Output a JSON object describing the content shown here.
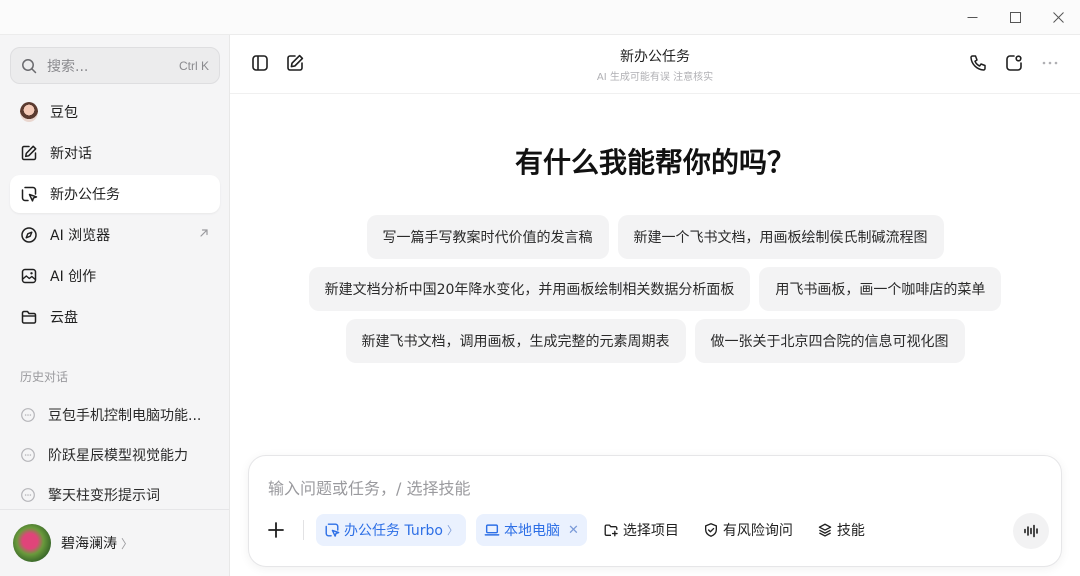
{
  "window": {
    "controls": [
      "minimize",
      "maximize",
      "close"
    ]
  },
  "search": {
    "placeholder": "搜索...",
    "shortcut": "Ctrl K"
  },
  "nav": [
    {
      "label": "豆包",
      "icon": "avatar-icon"
    },
    {
      "label": "新对话",
      "icon": "edit-icon"
    },
    {
      "label": "新办公任务",
      "icon": "office-task-icon",
      "active": true
    },
    {
      "label": "AI 浏览器",
      "icon": "compass-icon",
      "external": true
    },
    {
      "label": "AI 创作",
      "icon": "image-create-icon"
    },
    {
      "label": "云盘",
      "icon": "folder-icon"
    }
  ],
  "history": {
    "title": "历史对话",
    "items": [
      "豆包手机控制电脑功能...",
      "阶跃星辰模型视觉能力",
      "擎天柱变形提示词"
    ]
  },
  "user": {
    "name": "碧海澜涛",
    "chevron": "〉"
  },
  "header": {
    "title": "新办公任务",
    "subtitle": "AI 生成可能有误 注意核实"
  },
  "main": {
    "headline": "有什么我能帮你的吗？"
  },
  "suggestions": [
    [
      "写一篇手写教案时代价值的发言稿",
      "新建一个飞书文档，用画板绘制侯氏制碱流程图"
    ],
    [
      "新建文档分析中国20年降水变化，并用画板绘制相关数据分析面板",
      "用飞书画板，画一个咖啡店的菜单"
    ],
    [
      "新建飞书文档，调用画板，生成完整的元素周期表",
      "做一张关于北京四合院的信息可视化图"
    ]
  ],
  "composer": {
    "placeholder": "输入问题或任务，/ 选择技能",
    "mode_label": "办公任务 Turbo",
    "mode_arrow": "〉",
    "device_label": "本地电脑",
    "device_close": "✕",
    "project_label": "选择项目",
    "risk_label": "有风险询问",
    "skills_label": "技能"
  },
  "colors": {
    "accent": "#2d6fe6",
    "accent_bg": "#eaf1fe",
    "sidebar_bg": "#f5f5f6",
    "chip_bg": "#f3f3f4"
  }
}
